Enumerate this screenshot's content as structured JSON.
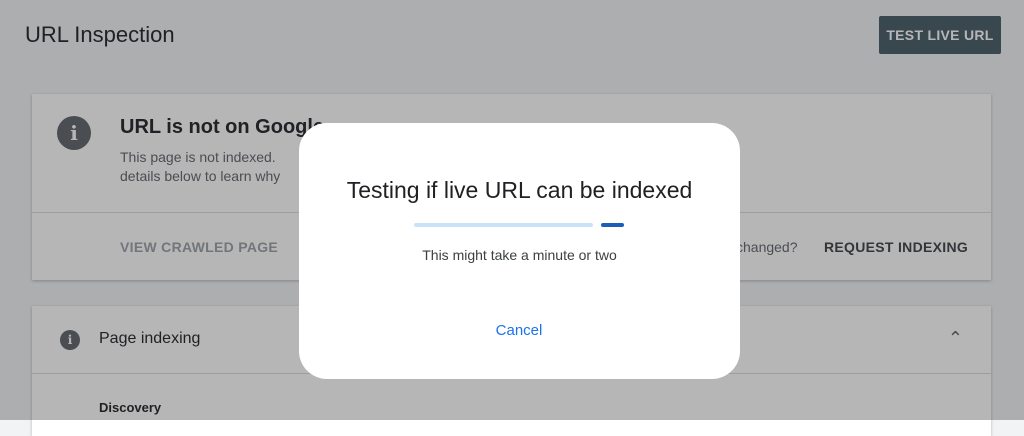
{
  "header": {
    "title": "URL Inspection",
    "test_live_url": "TEST LIVE URL"
  },
  "status_card": {
    "title": "URL is not on Google",
    "description": "This page is not indexed.\ndetails below to learn why",
    "view_crawled": "VIEW CRAWLED PAGE",
    "changed_question": "changed?",
    "request_indexing": "REQUEST INDEXING"
  },
  "page_indexing": {
    "title": "Page indexing",
    "discovery": "Discovery"
  },
  "dialog": {
    "title": "Testing if live URL can be indexed",
    "subtitle": "This might take a minute or two",
    "cancel": "Cancel",
    "progress_track_fraction": 0.87,
    "progress_indicator_fraction": 0.11
  },
  "icons": {
    "info": "info-icon",
    "chevron": "chevron-up-icon"
  },
  "colors": {
    "primary_button": "#455a64",
    "link_blue": "#1a73e8",
    "progress_fill": "#1a5fb4",
    "progress_track": "#c6e3f7"
  }
}
